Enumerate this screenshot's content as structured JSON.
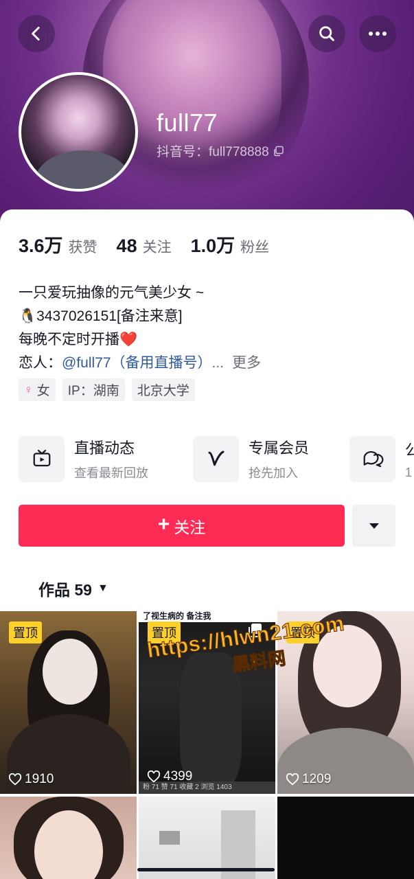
{
  "header": {
    "username": "full77",
    "douyin_id": "抖音号：full778888"
  },
  "stats": [
    {
      "value": "3.6万",
      "label": "获赞"
    },
    {
      "value": "48",
      "label": "关注"
    },
    {
      "value": "1.0万",
      "label": "粉丝"
    }
  ],
  "bio": {
    "line1": "一只爱玩抽像的元气美少女 ~",
    "line2": "🐧3437026151[备注来意]",
    "line3": "每晚不定时开播❤️",
    "lover_label": "恋人：",
    "lover_link": "@full77（备用直播号）",
    "ellipsis": "...",
    "more": "更多"
  },
  "tags": {
    "gender": "女",
    "ip": "IP：湖南",
    "school": "北京大学"
  },
  "features": [
    {
      "title": "直播动态",
      "subtitle": "查看最新回放",
      "icon": "tv-icon"
    },
    {
      "title": "专属会员",
      "subtitle": "抢先加入",
      "icon": "v-icon"
    },
    {
      "title": "公",
      "subtitle": "1",
      "icon": "chat-bubble-icon"
    }
  ],
  "actions": {
    "follow_plus": "+",
    "follow_label": "关注"
  },
  "works": {
    "label": "作品 59"
  },
  "grid": [
    {
      "pinned": "置顶",
      "likes": "1910"
    },
    {
      "pinned": "置顶",
      "likes": "4399",
      "top_text": "了视生病的 备注我",
      "bottom_text": "粉 71   赞 71   收藏 2   浏览 1403"
    },
    {
      "pinned": "置顶",
      "likes": "1209"
    }
  ],
  "watermark": {
    "url": "https://hlwn21.com",
    "site": "黑料网"
  },
  "colors": {
    "accent": "#fe2c55",
    "pin_badge": "#ffd02a",
    "header_purple": "#6e2f88"
  }
}
